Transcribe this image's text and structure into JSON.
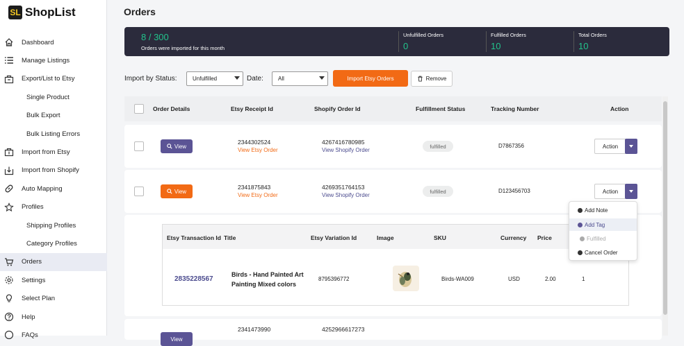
{
  "app": {
    "name": "ShopList",
    "logo_mark": "SL"
  },
  "sidebar": {
    "items": [
      {
        "label": "Dashboard",
        "icon": "home-icon"
      },
      {
        "label": "Manage Listings",
        "icon": "list-icon"
      },
      {
        "label": "Export/List to Etsy",
        "icon": "export-icon"
      },
      {
        "label": "Single Product",
        "sub": true
      },
      {
        "label": "Bulk Export",
        "sub": true
      },
      {
        "label": "Bulk Listing Errors",
        "sub": true
      },
      {
        "label": "Import from Etsy",
        "icon": "import-icon"
      },
      {
        "label": "Import from Shopify",
        "icon": "download-icon"
      },
      {
        "label": "Auto Mapping",
        "icon": "link-icon"
      },
      {
        "label": "Profiles",
        "icon": "star-icon"
      },
      {
        "label": "Shipping Profiles",
        "sub": true
      },
      {
        "label": "Category Profiles",
        "sub": true
      },
      {
        "label": "Orders",
        "icon": "cart-icon",
        "active": true
      },
      {
        "label": "Settings",
        "icon": "gear-icon"
      },
      {
        "label": "Select Plan",
        "icon": "bulb-icon"
      },
      {
        "label": "Help",
        "icon": "help-icon"
      },
      {
        "label": "FAQs",
        "icon": "faq-icon"
      }
    ]
  },
  "page": {
    "title": "Orders"
  },
  "banner": {
    "count": "8 / 300",
    "count_note": "Orders were imported for this month",
    "unfulfilled_label": "Unfulfilled Orders",
    "unfulfilled_value": "0",
    "fulfilled_label": "Fulfilled Orders",
    "fulfilled_value": "10",
    "total_label": "Total Orders",
    "total_value": "10"
  },
  "filters": {
    "status_label": "Import by Status:",
    "status_value": "Unfulfilled",
    "date_label": "Date:",
    "date_value": "All",
    "import_button": "Import Etsy Orders",
    "remove_button": "Remove"
  },
  "table": {
    "headers": [
      "Order Details",
      "Etsy Receipt Id",
      "Shopify Order Id",
      "Fulfillment Status",
      "Tracking Number",
      "Action"
    ],
    "rows": [
      {
        "view": "View",
        "receipt": "2344302524",
        "receipt_link": "View Etsy Order",
        "shopify": "4267416780985",
        "shopify_link": "View Shopify Order",
        "status": "fulfilled",
        "tracking": "D7867356",
        "action": "Action"
      },
      {
        "view": "View",
        "receipt": "2341875843",
        "receipt_link": "View Etsy Order",
        "shopify": "4269351764153",
        "shopify_link": "View Shopify Order",
        "status": "fulfilled",
        "tracking": "D123456703",
        "action": "Action"
      }
    ],
    "partial_row": {
      "view": "View",
      "receipt": "2341473990",
      "shopify": "4252966617273"
    }
  },
  "detail": {
    "headers": [
      "Etsy Transaction Id",
      "Title",
      "Etsy Variation Id",
      "Image",
      "SKU",
      "Currency",
      "Price"
    ],
    "row": {
      "transaction": "2835228567",
      "title": "Birds - Hand Painted Art Painting Mixed colors",
      "variation": "8795396772",
      "sku": "Birds-WA009",
      "currency": "USD",
      "price": "2.00",
      "qty": "1"
    }
  },
  "dropdown": {
    "items": [
      {
        "label": "Add Note"
      },
      {
        "label": "Add Tag"
      },
      {
        "label": "Fulfilled"
      },
      {
        "label": "Cancel Order"
      }
    ]
  },
  "colors": {
    "accent": "#f26a15",
    "brand": "#5b5495",
    "banner": "#2b2b3c",
    "green": "#22c38c"
  }
}
